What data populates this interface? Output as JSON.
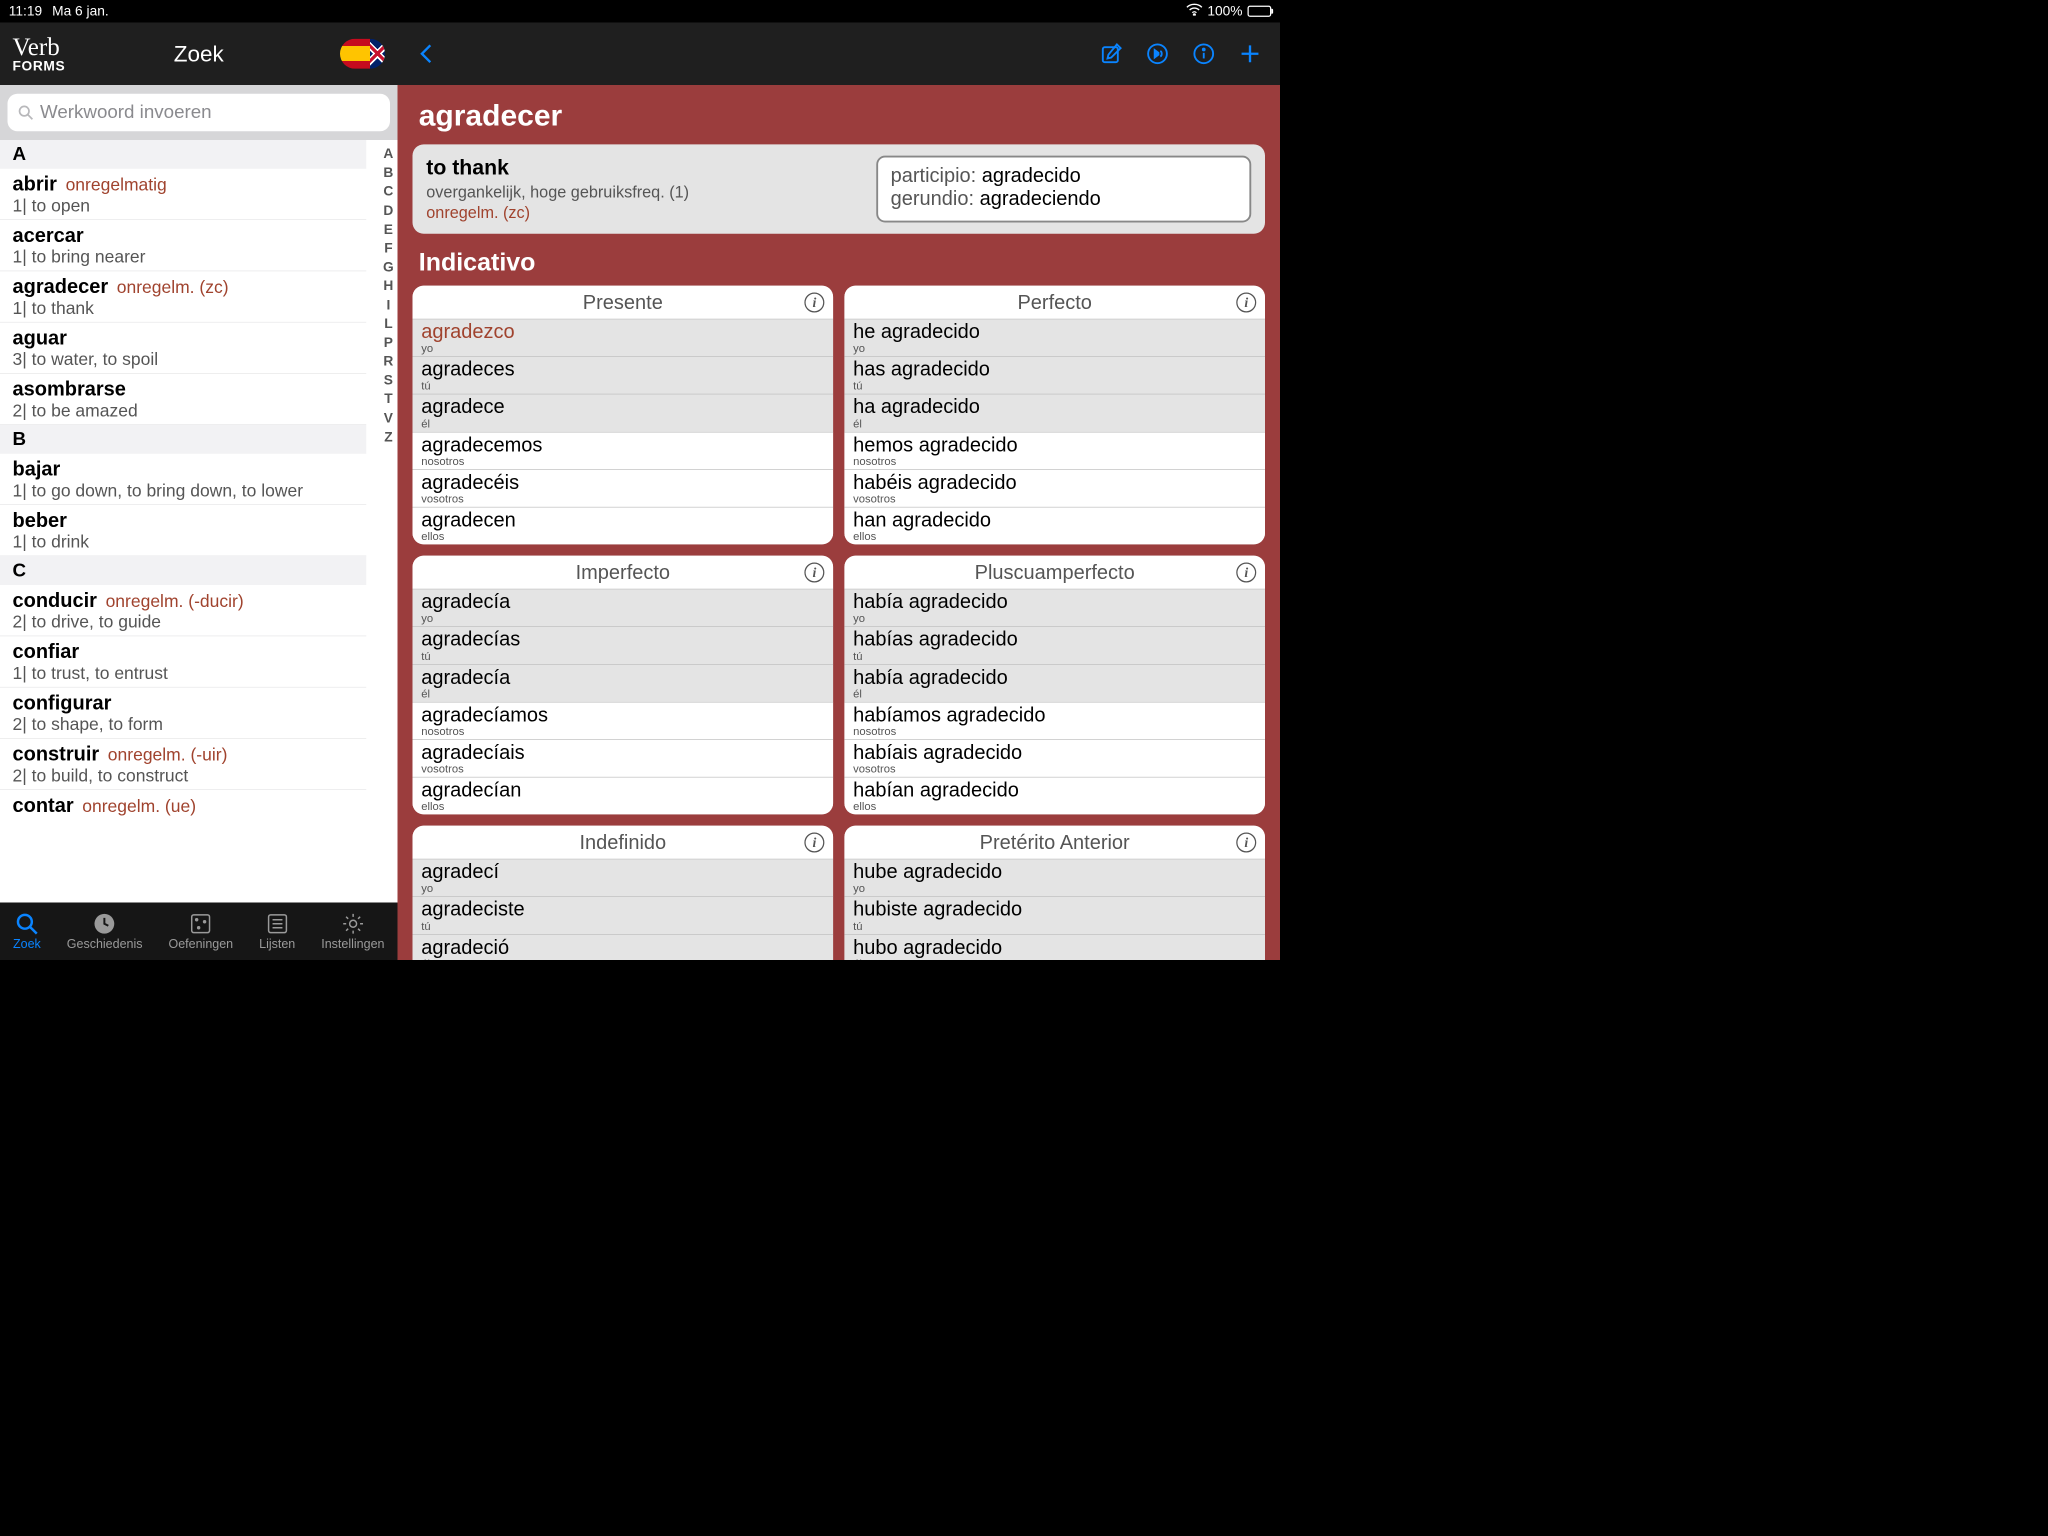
{
  "status": {
    "time": "11:19",
    "date": "Ma 6 jan.",
    "battery": "100%"
  },
  "sidebar": {
    "title": "Zoek",
    "logo_top": "Verb",
    "logo_bottom": "FORMS",
    "search_placeholder": "Werkwoord invoeren",
    "sections": [
      {
        "letter": "A",
        "items": [
          {
            "verb": "abrir",
            "tag": "onregelmatig",
            "sub": "1| to open"
          },
          {
            "verb": "acercar",
            "tag": "",
            "sub": "1| to bring nearer"
          },
          {
            "verb": "agradecer",
            "tag": "onregelm. (zc)",
            "sub": "1| to thank"
          },
          {
            "verb": "aguar",
            "tag": "",
            "sub": "3| to water, to spoil"
          },
          {
            "verb": "asombrarse",
            "tag": "",
            "sub": "2| to be amazed"
          }
        ]
      },
      {
        "letter": "B",
        "items": [
          {
            "verb": "bajar",
            "tag": "",
            "sub": "1| to go down, to bring down, to lower"
          },
          {
            "verb": "beber",
            "tag": "",
            "sub": "1| to drink"
          }
        ]
      },
      {
        "letter": "C",
        "items": [
          {
            "verb": "conducir",
            "tag": "onregelm. (-ducir)",
            "sub": "2| to drive, to guide"
          },
          {
            "verb": "confiar",
            "tag": "",
            "sub": "1| to trust, to entrust"
          },
          {
            "verb": "configurar",
            "tag": "",
            "sub": "2| to shape, to form"
          },
          {
            "verb": "construir",
            "tag": "onregelm. (-uir)",
            "sub": "2| to build, to construct"
          },
          {
            "verb": "contar",
            "tag": "onregelm. (ue)",
            "sub": ""
          }
        ]
      }
    ],
    "index": [
      "A",
      "B",
      "C",
      "D",
      "E",
      "F",
      "G",
      "H",
      "I",
      "L",
      "P",
      "R",
      "S",
      "T",
      "V",
      "Z"
    ],
    "tabs": [
      {
        "label": "Zoek",
        "icon": "search",
        "active": true
      },
      {
        "label": "Geschiedenis",
        "icon": "clock",
        "active": false
      },
      {
        "label": "Oefeningen",
        "icon": "dots",
        "active": false
      },
      {
        "label": "Lijsten",
        "icon": "list",
        "active": false
      },
      {
        "label": "Instellingen",
        "icon": "gear",
        "active": false
      }
    ]
  },
  "detail": {
    "verb": "agradecer",
    "translation": "to thank",
    "meta": "overgankelijk, hoge gebruiksfreq. (1)",
    "meta2": "onregelm. (zc)",
    "participio_label": "participio:",
    "participio": "agradecido",
    "gerundio_label": "gerundio:",
    "gerundio": "agradeciendo",
    "mood": "Indicativo",
    "pronouns": [
      "yo",
      "tú",
      "él",
      "nosotros",
      "vosotros",
      "ellos"
    ],
    "rows": [
      [
        {
          "title": "Presente",
          "forms": [
            "agradezco",
            "agradeces",
            "agradece",
            "agradecemos",
            "agradecéis",
            "agradecen"
          ],
          "hl": [
            0
          ]
        },
        {
          "title": "Perfecto",
          "forms": [
            "he agradecido",
            "has agradecido",
            "ha agradecido",
            "hemos agradecido",
            "habéis agradecido",
            "han agradecido"
          ],
          "hl": []
        }
      ],
      [
        {
          "title": "Imperfecto",
          "forms": [
            "agradecía",
            "agradecías",
            "agradecía",
            "agradecíamos",
            "agradecíais",
            "agradecían"
          ],
          "hl": []
        },
        {
          "title": "Pluscuamperfecto",
          "forms": [
            "había agradecido",
            "habías agradecido",
            "había agradecido",
            "habíamos agradecido",
            "habíais agradecido",
            "habían agradecido"
          ],
          "hl": []
        }
      ],
      [
        {
          "title": "Indefinido",
          "forms": [
            "agradecí",
            "agradeciste",
            "agradeció"
          ],
          "hl": []
        },
        {
          "title": "Pretérito Anterior",
          "forms": [
            "hube agradecido",
            "hubiste agradecido",
            "hubo agradecido"
          ],
          "hl": []
        }
      ]
    ]
  }
}
